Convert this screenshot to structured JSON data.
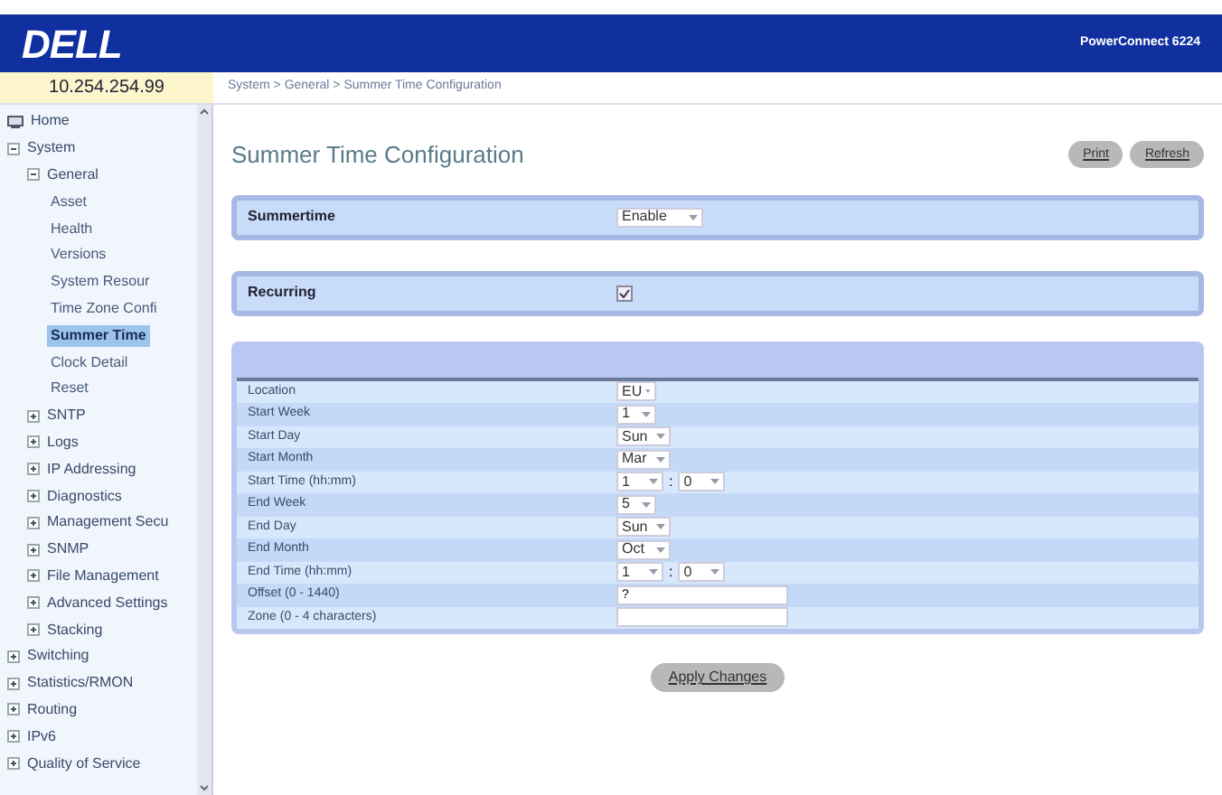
{
  "header": {
    "logo": "DELL",
    "product": "PowerConnect 6224"
  },
  "device_ip": "10.254.254.99",
  "breadcrumb": "System > General > Summer Time Configuration",
  "sidebar": {
    "items": [
      {
        "label": "Home",
        "kind": "root"
      },
      {
        "label": "System",
        "expanded": true,
        "children": [
          {
            "label": "General",
            "expanded": true,
            "children": [
              {
                "label": "Asset",
                "selected": false
              },
              {
                "label": "Health",
                "selected": false
              },
              {
                "label": "Versions",
                "selected": false
              },
              {
                "label": "System Resour",
                "selected": false
              },
              {
                "label": "Time Zone Confi",
                "selected": false
              },
              {
                "label": "Summer Time",
                "selected": true
              },
              {
                "label": "Clock Detail",
                "selected": false
              },
              {
                "label": "Reset",
                "selected": false
              }
            ]
          },
          {
            "label": "SNTP",
            "expanded": false
          },
          {
            "label": "Logs",
            "expanded": false
          },
          {
            "label": "IP Addressing",
            "expanded": false
          },
          {
            "label": "Diagnostics",
            "expanded": false
          },
          {
            "label": "Management Secu",
            "expanded": false
          },
          {
            "label": "SNMP",
            "expanded": false
          },
          {
            "label": "File Management",
            "expanded": false
          },
          {
            "label": "Advanced Settings",
            "expanded": false
          },
          {
            "label": "Stacking",
            "expanded": false
          }
        ]
      },
      {
        "label": "Switching",
        "expanded": false
      },
      {
        "label": "Statistics/RMON",
        "expanded": false
      },
      {
        "label": "Routing",
        "expanded": false
      },
      {
        "label": "IPv6",
        "expanded": false
      },
      {
        "label": "Quality of Service",
        "expanded": false
      }
    ]
  },
  "page": {
    "title": "Summer Time Configuration",
    "buttons": [
      "Print",
      "Refresh"
    ],
    "summertime": {
      "label": "Summertime",
      "value": "Enable"
    },
    "recurring": {
      "label": "Recurring",
      "checked": true
    },
    "fields": [
      {
        "kind": "select",
        "label": "Location",
        "value": "EU"
      },
      {
        "kind": "select",
        "label": "Start Week",
        "value": "1"
      },
      {
        "kind": "select",
        "label": "Start Day",
        "value": "Sun"
      },
      {
        "kind": "select",
        "label": "Start Month",
        "value": "Mar"
      },
      {
        "kind": "time",
        "label": "Start Time (hh:mm)",
        "value": "1",
        "value2": "0",
        "separator": ":"
      },
      {
        "kind": "select",
        "label": "End Week",
        "value": "5"
      },
      {
        "kind": "select",
        "label": "End Day",
        "value": "Sun"
      },
      {
        "kind": "select",
        "label": "End Month",
        "value": "Oct"
      },
      {
        "kind": "time",
        "label": "End Time (hh:mm)",
        "value": "1",
        "value2": "0",
        "separator": ":"
      },
      {
        "kind": "text",
        "label": "Offset (0 - 1440)",
        "value": "?"
      },
      {
        "kind": "text",
        "label": "Zone (0 - 4 characters)"
      }
    ],
    "apply_button": "Apply Changes"
  }
}
